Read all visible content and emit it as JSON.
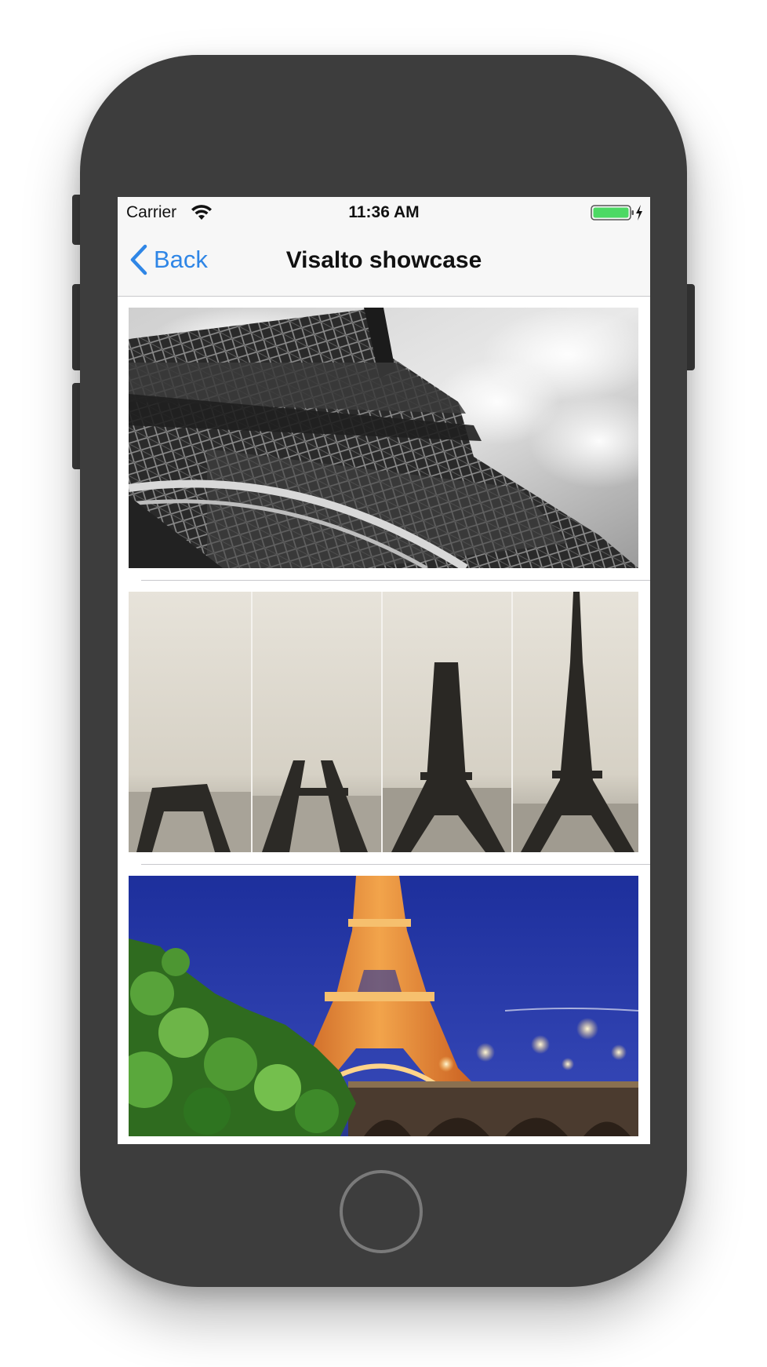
{
  "status_bar": {
    "carrier": "Carrier",
    "time": "11:36 AM",
    "wifi_icon": "wifi-icon",
    "battery_icon": "battery-charging-icon",
    "battery_color": "#4cd964"
  },
  "nav_bar": {
    "back_label": "Back",
    "title": "Visalto showcase",
    "accent_color": "#2f86e6"
  },
  "images": [
    {
      "name": "eiffel-tower-black-and-white"
    },
    {
      "name": "eiffel-tower-construction-sequence"
    },
    {
      "name": "eiffel-tower-night-illuminated"
    }
  ]
}
